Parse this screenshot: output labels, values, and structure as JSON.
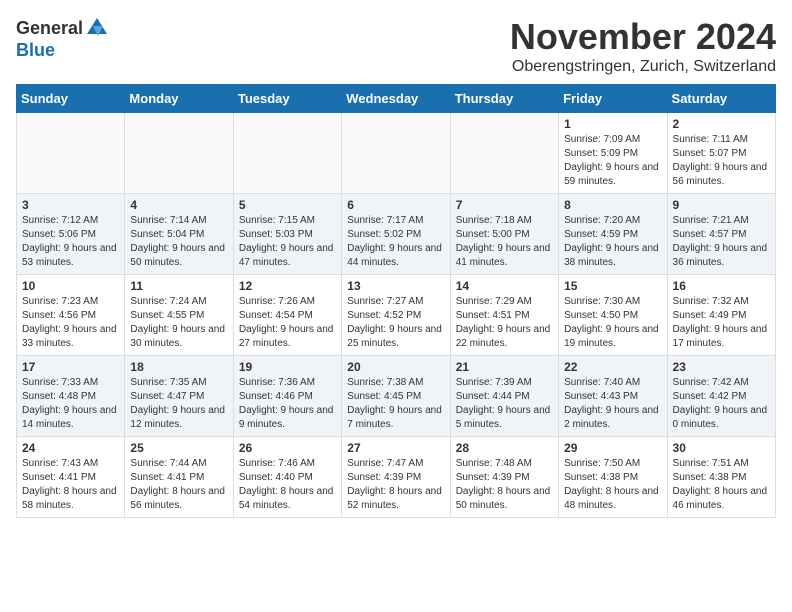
{
  "header": {
    "logo_general": "General",
    "logo_blue": "Blue",
    "month_title": "November 2024",
    "location": "Oberengstringen, Zurich, Switzerland"
  },
  "days_of_week": [
    "Sunday",
    "Monday",
    "Tuesday",
    "Wednesday",
    "Thursday",
    "Friday",
    "Saturday"
  ],
  "weeks": [
    {
      "days": [
        {
          "num": "",
          "info": ""
        },
        {
          "num": "",
          "info": ""
        },
        {
          "num": "",
          "info": ""
        },
        {
          "num": "",
          "info": ""
        },
        {
          "num": "",
          "info": ""
        },
        {
          "num": "1",
          "info": "Sunrise: 7:09 AM\nSunset: 5:09 PM\nDaylight: 9 hours and 59 minutes."
        },
        {
          "num": "2",
          "info": "Sunrise: 7:11 AM\nSunset: 5:07 PM\nDaylight: 9 hours and 56 minutes."
        }
      ]
    },
    {
      "days": [
        {
          "num": "3",
          "info": "Sunrise: 7:12 AM\nSunset: 5:06 PM\nDaylight: 9 hours and 53 minutes."
        },
        {
          "num": "4",
          "info": "Sunrise: 7:14 AM\nSunset: 5:04 PM\nDaylight: 9 hours and 50 minutes."
        },
        {
          "num": "5",
          "info": "Sunrise: 7:15 AM\nSunset: 5:03 PM\nDaylight: 9 hours and 47 minutes."
        },
        {
          "num": "6",
          "info": "Sunrise: 7:17 AM\nSunset: 5:02 PM\nDaylight: 9 hours and 44 minutes."
        },
        {
          "num": "7",
          "info": "Sunrise: 7:18 AM\nSunset: 5:00 PM\nDaylight: 9 hours and 41 minutes."
        },
        {
          "num": "8",
          "info": "Sunrise: 7:20 AM\nSunset: 4:59 PM\nDaylight: 9 hours and 38 minutes."
        },
        {
          "num": "9",
          "info": "Sunrise: 7:21 AM\nSunset: 4:57 PM\nDaylight: 9 hours and 36 minutes."
        }
      ]
    },
    {
      "days": [
        {
          "num": "10",
          "info": "Sunrise: 7:23 AM\nSunset: 4:56 PM\nDaylight: 9 hours and 33 minutes."
        },
        {
          "num": "11",
          "info": "Sunrise: 7:24 AM\nSunset: 4:55 PM\nDaylight: 9 hours and 30 minutes."
        },
        {
          "num": "12",
          "info": "Sunrise: 7:26 AM\nSunset: 4:54 PM\nDaylight: 9 hours and 27 minutes."
        },
        {
          "num": "13",
          "info": "Sunrise: 7:27 AM\nSunset: 4:52 PM\nDaylight: 9 hours and 25 minutes."
        },
        {
          "num": "14",
          "info": "Sunrise: 7:29 AM\nSunset: 4:51 PM\nDaylight: 9 hours and 22 minutes."
        },
        {
          "num": "15",
          "info": "Sunrise: 7:30 AM\nSunset: 4:50 PM\nDaylight: 9 hours and 19 minutes."
        },
        {
          "num": "16",
          "info": "Sunrise: 7:32 AM\nSunset: 4:49 PM\nDaylight: 9 hours and 17 minutes."
        }
      ]
    },
    {
      "days": [
        {
          "num": "17",
          "info": "Sunrise: 7:33 AM\nSunset: 4:48 PM\nDaylight: 9 hours and 14 minutes."
        },
        {
          "num": "18",
          "info": "Sunrise: 7:35 AM\nSunset: 4:47 PM\nDaylight: 9 hours and 12 minutes."
        },
        {
          "num": "19",
          "info": "Sunrise: 7:36 AM\nSunset: 4:46 PM\nDaylight: 9 hours and 9 minutes."
        },
        {
          "num": "20",
          "info": "Sunrise: 7:38 AM\nSunset: 4:45 PM\nDaylight: 9 hours and 7 minutes."
        },
        {
          "num": "21",
          "info": "Sunrise: 7:39 AM\nSunset: 4:44 PM\nDaylight: 9 hours and 5 minutes."
        },
        {
          "num": "22",
          "info": "Sunrise: 7:40 AM\nSunset: 4:43 PM\nDaylight: 9 hours and 2 minutes."
        },
        {
          "num": "23",
          "info": "Sunrise: 7:42 AM\nSunset: 4:42 PM\nDaylight: 9 hours and 0 minutes."
        }
      ]
    },
    {
      "days": [
        {
          "num": "24",
          "info": "Sunrise: 7:43 AM\nSunset: 4:41 PM\nDaylight: 8 hours and 58 minutes."
        },
        {
          "num": "25",
          "info": "Sunrise: 7:44 AM\nSunset: 4:41 PM\nDaylight: 8 hours and 56 minutes."
        },
        {
          "num": "26",
          "info": "Sunrise: 7:46 AM\nSunset: 4:40 PM\nDaylight: 8 hours and 54 minutes."
        },
        {
          "num": "27",
          "info": "Sunrise: 7:47 AM\nSunset: 4:39 PM\nDaylight: 8 hours and 52 minutes."
        },
        {
          "num": "28",
          "info": "Sunrise: 7:48 AM\nSunset: 4:39 PM\nDaylight: 8 hours and 50 minutes."
        },
        {
          "num": "29",
          "info": "Sunrise: 7:50 AM\nSunset: 4:38 PM\nDaylight: 8 hours and 48 minutes."
        },
        {
          "num": "30",
          "info": "Sunrise: 7:51 AM\nSunset: 4:38 PM\nDaylight: 8 hours and 46 minutes."
        }
      ]
    }
  ]
}
